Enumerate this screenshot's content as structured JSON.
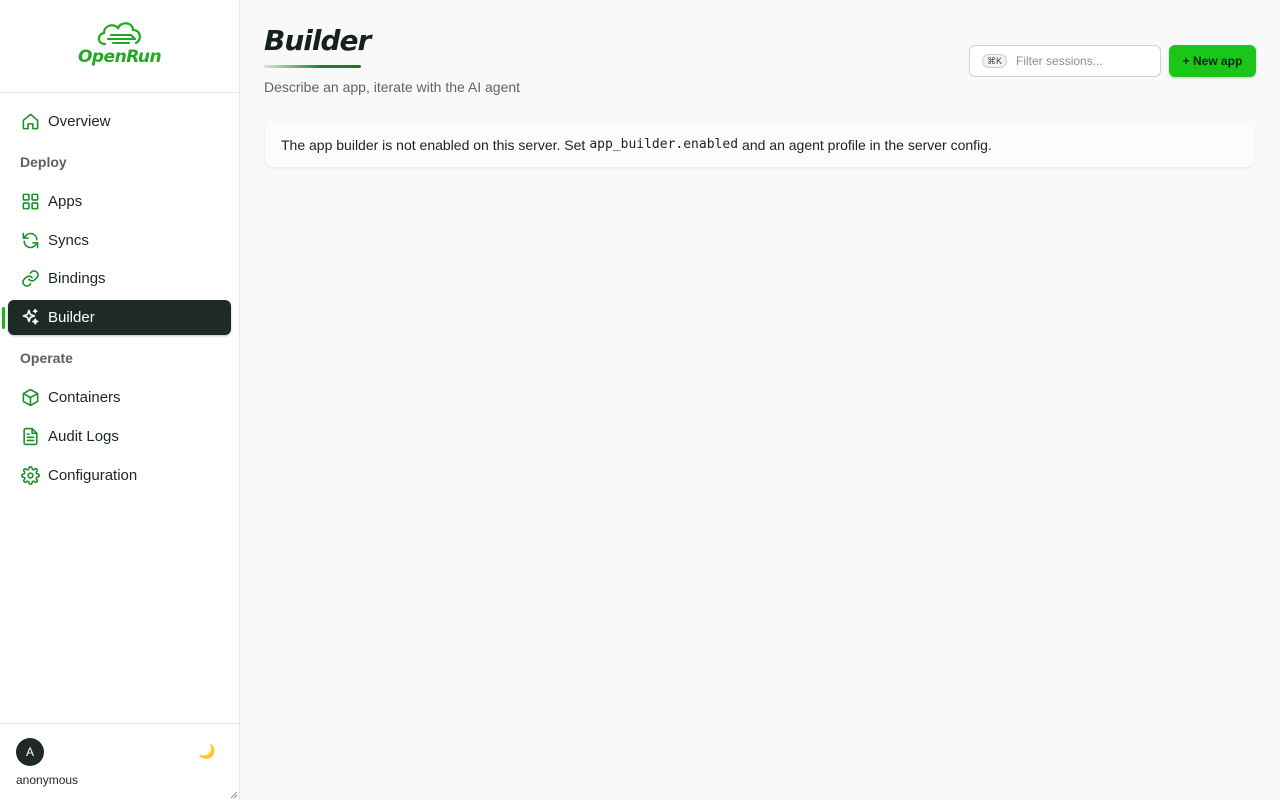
{
  "brand": {
    "name": "OpenRun",
    "color": "#1faa1f"
  },
  "sidebar": {
    "overview": {
      "label": "Overview",
      "icon": "home-icon"
    },
    "sections": [
      {
        "label": "Deploy"
      },
      {
        "label": "Operate"
      }
    ],
    "deploy_items": [
      {
        "label": "Apps",
        "icon": "grid-icon"
      },
      {
        "label": "Syncs",
        "icon": "refresh-icon"
      },
      {
        "label": "Bindings",
        "icon": "link-icon"
      },
      {
        "label": "Builder",
        "icon": "sparkles-icon",
        "active": true
      }
    ],
    "operate_items": [
      {
        "label": "Containers",
        "icon": "box-icon"
      },
      {
        "label": "Audit Logs",
        "icon": "file-text-icon"
      },
      {
        "label": "Configuration",
        "icon": "gear-icon"
      }
    ],
    "user": {
      "avatar_letter": "A",
      "name": "anonymous"
    },
    "theme_toggle_glyph": "🌙"
  },
  "header": {
    "title": "Builder",
    "subtitle": "Describe an app, iterate with the AI agent",
    "search": {
      "shortcut": "⌘K",
      "placeholder": "Filter sessions..."
    },
    "new_app_label": "+ New app",
    "accent_color": "#19c619"
  },
  "notice": {
    "text_before": "The app builder is not enabled on this server. Set",
    "code": "app_builder.enabled",
    "text_after": "and an agent profile in the server config."
  }
}
